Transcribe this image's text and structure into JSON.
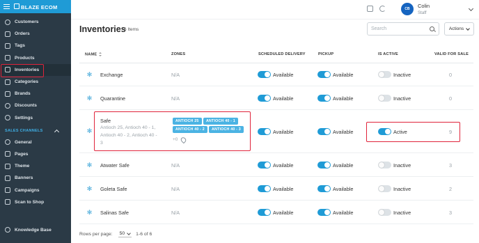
{
  "app": {
    "brand": "BLAZE ECOM"
  },
  "sidebar": {
    "items": [
      {
        "label": "Customers",
        "icon": "users-icon"
      },
      {
        "label": "Orders",
        "icon": "orders-icon"
      },
      {
        "label": "Tags",
        "icon": "tag-icon"
      },
      {
        "label": "Products",
        "icon": "products-icon"
      },
      {
        "label": "Inventories",
        "icon": "inventory-icon"
      },
      {
        "label": "Categories",
        "icon": "categories-icon"
      },
      {
        "label": "Brands",
        "icon": "brands-icon"
      },
      {
        "label": "Discounts",
        "icon": "discount-icon"
      },
      {
        "label": "Settings",
        "icon": "gear-icon"
      }
    ],
    "section_label": "SALES CHANNELS",
    "channel_items": [
      {
        "label": "General",
        "icon": "globe-icon"
      },
      {
        "label": "Pages",
        "icon": "pages-icon"
      },
      {
        "label": "Theme",
        "icon": "theme-icon"
      },
      {
        "label": "Banners",
        "icon": "banner-icon"
      },
      {
        "label": "Campaigns",
        "icon": "campaign-icon"
      },
      {
        "label": "Scan to Shop",
        "icon": "scan-icon"
      }
    ],
    "knowledge_base": "Knowledge Base",
    "active_item": "Inventories"
  },
  "topbar": {
    "avatar_initials": "CB",
    "user_name": "Colin",
    "user_role": "Staff"
  },
  "page": {
    "title": "Inventories",
    "count": "6 Items",
    "search_placeholder": "Search",
    "actions_label": "Actions"
  },
  "table": {
    "headers": {
      "name": "NAME",
      "zones": "ZONES",
      "scheduled_delivery": "SCHEDULED DELIVERY",
      "pickup": "PICKUP",
      "is_active": "IS ACTIVE",
      "valid_for_sale": "VALID FOR SALE"
    },
    "rows": [
      {
        "name": "Exchange",
        "zones": "N/A",
        "delivery": "Available",
        "pickup": "Available",
        "active": "Inactive",
        "active_on": false,
        "valid": "0"
      },
      {
        "name": "Quarantine",
        "zones": "N/A",
        "delivery": "Available",
        "pickup": "Available",
        "active": "Inactive",
        "active_on": false,
        "valid": "0"
      },
      {
        "name": "Safe",
        "subtitle_1": "Antioch 25, Antioch 40 - 1,",
        "subtitle_2": "Antioch 40 - 2, Antioch 40 -",
        "subtitle_3": "3",
        "zone_chips": [
          "ANTIOCH 25",
          "ANTIOCH 40 - 1",
          "ANTIOCH 40 - 2",
          "ANTIOCH 40 - 3"
        ],
        "zones_more": "+0",
        "delivery": "Available",
        "pickup": "Available",
        "active": "Active",
        "active_on": true,
        "valid": "9"
      },
      {
        "name": "Atwater Safe",
        "zones": "N/A",
        "delivery": "Available",
        "pickup": "Available",
        "active": "Inactive",
        "active_on": false,
        "valid": "3"
      },
      {
        "name": "Goleta Safe",
        "zones": "N/A",
        "delivery": "Available",
        "pickup": "Available",
        "active": "Inactive",
        "active_on": false,
        "valid": "2"
      },
      {
        "name": "Salinas Safe",
        "zones": "N/A",
        "delivery": "Available",
        "pickup": "Available",
        "active": "Inactive",
        "active_on": false,
        "valid": "3"
      }
    ]
  },
  "pagination": {
    "rows_per_page_label": "Rows per page:",
    "rows_per_page": "50",
    "range": "1-6 of 6"
  },
  "colors": {
    "sidebar_bg": "#2b3a46",
    "brand_bg": "#1f9bd6",
    "accent": "#1f9bd6",
    "chip": "#4bb3e3",
    "highlight": "#e0233a"
  }
}
